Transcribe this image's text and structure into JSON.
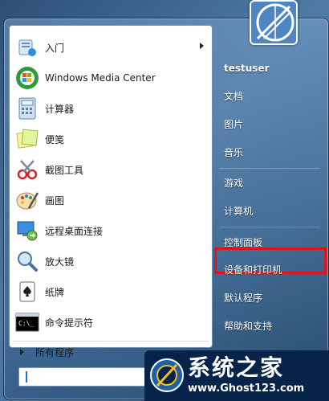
{
  "programs": [
    {
      "label": "入门",
      "icon": "getting-started-icon",
      "has_submenu": true
    },
    {
      "label": "Windows Media Center",
      "icon": "media-center-icon",
      "has_submenu": false
    },
    {
      "label": "计算器",
      "icon": "calculator-icon",
      "has_submenu": false
    },
    {
      "label": "便笺",
      "icon": "sticky-notes-icon",
      "has_submenu": false
    },
    {
      "label": "截图工具",
      "icon": "snipping-tool-icon",
      "has_submenu": false
    },
    {
      "label": "画图",
      "icon": "paint-icon",
      "has_submenu": false
    },
    {
      "label": "远程桌面连接",
      "icon": "remote-desktop-icon",
      "has_submenu": false
    },
    {
      "label": "放大镜",
      "icon": "magnifier-icon",
      "has_submenu": false
    },
    {
      "label": "纸牌",
      "icon": "solitaire-icon",
      "has_submenu": false
    },
    {
      "label": "命令提示符",
      "icon": "command-prompt-icon",
      "has_submenu": false
    }
  ],
  "all_programs": "所有程序",
  "search": {
    "value": "",
    "placeholder": ""
  },
  "right_pane": {
    "username": "testuser",
    "items": [
      "文档",
      "图片",
      "音乐",
      "游戏",
      "计算机",
      "控制面板",
      "设备和打印机",
      "默认程序",
      "帮助和支持"
    ],
    "highlighted": "控制面板"
  },
  "watermark": {
    "title": "系统之家",
    "url": "www.Ghost123.com"
  },
  "colors": {
    "highlight_border": "#e0141b",
    "watermark_bg": "#06234a"
  }
}
